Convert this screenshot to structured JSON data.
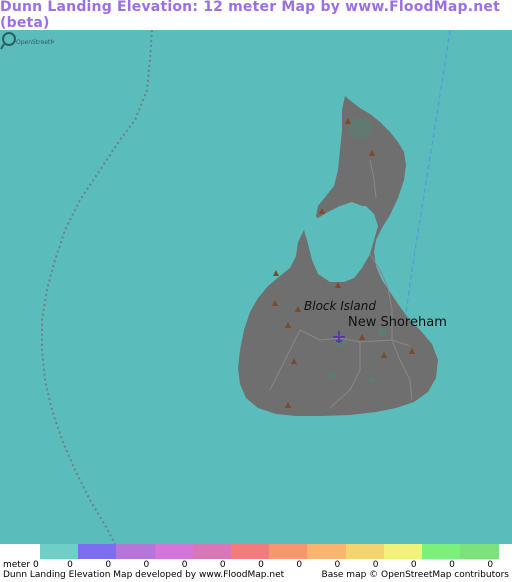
{
  "title": "Dunn Landing Elevation: 12 meter Map by www.FloodMap.net (beta)",
  "map": {
    "labels": {
      "island": "Block Island",
      "town": "New Shoreham"
    },
    "icons": [
      "peak-icon",
      "airport-icon",
      "openstreetmap-logo"
    ],
    "colors": {
      "water": "#5bbcbc",
      "land": "#6f6f6f"
    }
  },
  "legend": {
    "unit": "meter",
    "first_value": "0",
    "values": [
      "0",
      "0",
      "0",
      "0",
      "0",
      "0",
      "0",
      "0",
      "0",
      "0",
      "0",
      "0"
    ],
    "colors": [
      "#6fcfc7",
      "#7b6ef0",
      "#b676d8",
      "#d277d8",
      "#d777b8",
      "#f47b7b",
      "#f69770",
      "#f7b56f",
      "#f5d36f",
      "#f2f27a",
      "#7bf07b",
      "#7de27d"
    ]
  },
  "footer": {
    "left": "Dunn Landing Elevation Map developed by www.FloodMap.net",
    "right": "Base map © OpenStreetMap contributors"
  }
}
